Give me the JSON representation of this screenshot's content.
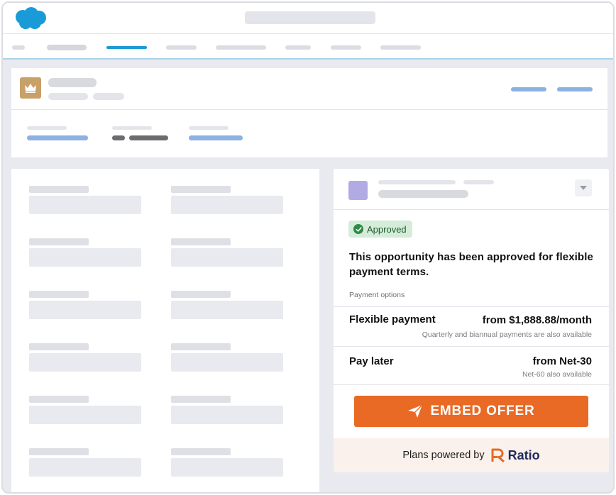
{
  "colors": {
    "accent_blue": "#1a9bd7",
    "cta_orange": "#e96a24",
    "approved_green": "#2f8a47",
    "brand_navy": "#1f2a5c"
  },
  "header": {
    "logo_icon": "salesforce-cloud-icon"
  },
  "record": {
    "icon": "crown-icon"
  },
  "widget": {
    "dropdown_icon": "chevron-down-icon",
    "status_badge": "Approved",
    "status_icon": "check-circle-icon",
    "message": "This opportunity has been approved for flexible payment terms.",
    "section_label": "Payment options",
    "options": [
      {
        "title": "Flexible payment",
        "value": "from $1,888.88/month",
        "note": "Quarterly and biannual payments are also available"
      },
      {
        "title": "Pay later",
        "value": "from Net-30",
        "note": "Net-60 also available"
      }
    ],
    "cta_label": "EMBED OFFER",
    "cta_icon": "send-icon",
    "footer_text": "Plans powered by",
    "brand_name": "Ratio",
    "brand_icon": "ratio-logo-icon"
  }
}
